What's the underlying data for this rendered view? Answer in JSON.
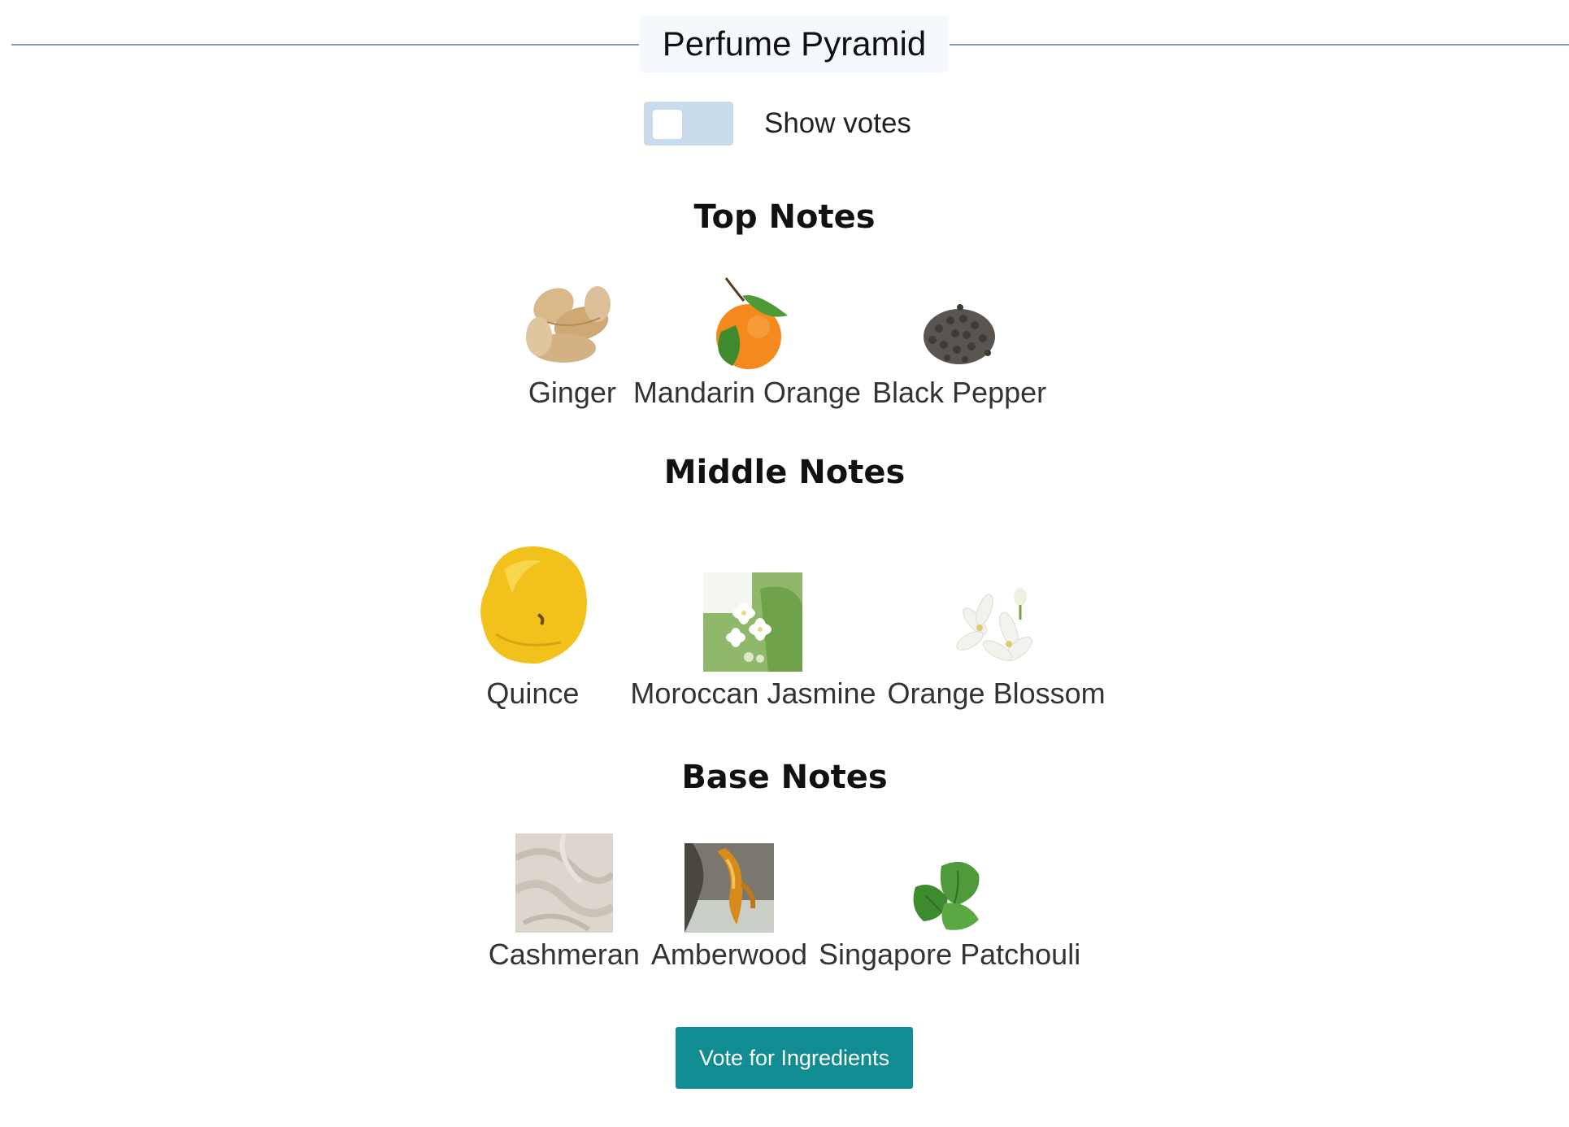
{
  "header": {
    "title": "Perfume Pyramid"
  },
  "votes_toggle": {
    "label": "Show votes",
    "on": false
  },
  "sections": {
    "top": {
      "heading": "Top Notes",
      "notes": [
        {
          "name": "Ginger",
          "icon": "ginger-root-icon"
        },
        {
          "name": "Mandarin Orange",
          "icon": "mandarin-orange-icon"
        },
        {
          "name": "Black Pepper",
          "icon": "black-pepper-icon"
        }
      ]
    },
    "middle": {
      "heading": "Middle Notes",
      "notes": [
        {
          "name": "Quince",
          "icon": "quince-icon"
        },
        {
          "name": "Moroccan Jasmine",
          "icon": "jasmine-icon"
        },
        {
          "name": "Orange Blossom",
          "icon": "orange-blossom-icon"
        }
      ]
    },
    "base": {
      "heading": "Base Notes",
      "notes": [
        {
          "name": "Cashmeran",
          "icon": "cashmere-fabric-icon"
        },
        {
          "name": "Amberwood",
          "icon": "amberwood-icon"
        },
        {
          "name": "Singapore Patchouli",
          "icon": "patchouli-leaf-icon"
        }
      ]
    }
  },
  "vote_button": {
    "label": "Vote for Ingredients"
  },
  "colors": {
    "accent": "#108c92",
    "toggle_track": "#c9dced",
    "divider": "#7f9cc8"
  }
}
